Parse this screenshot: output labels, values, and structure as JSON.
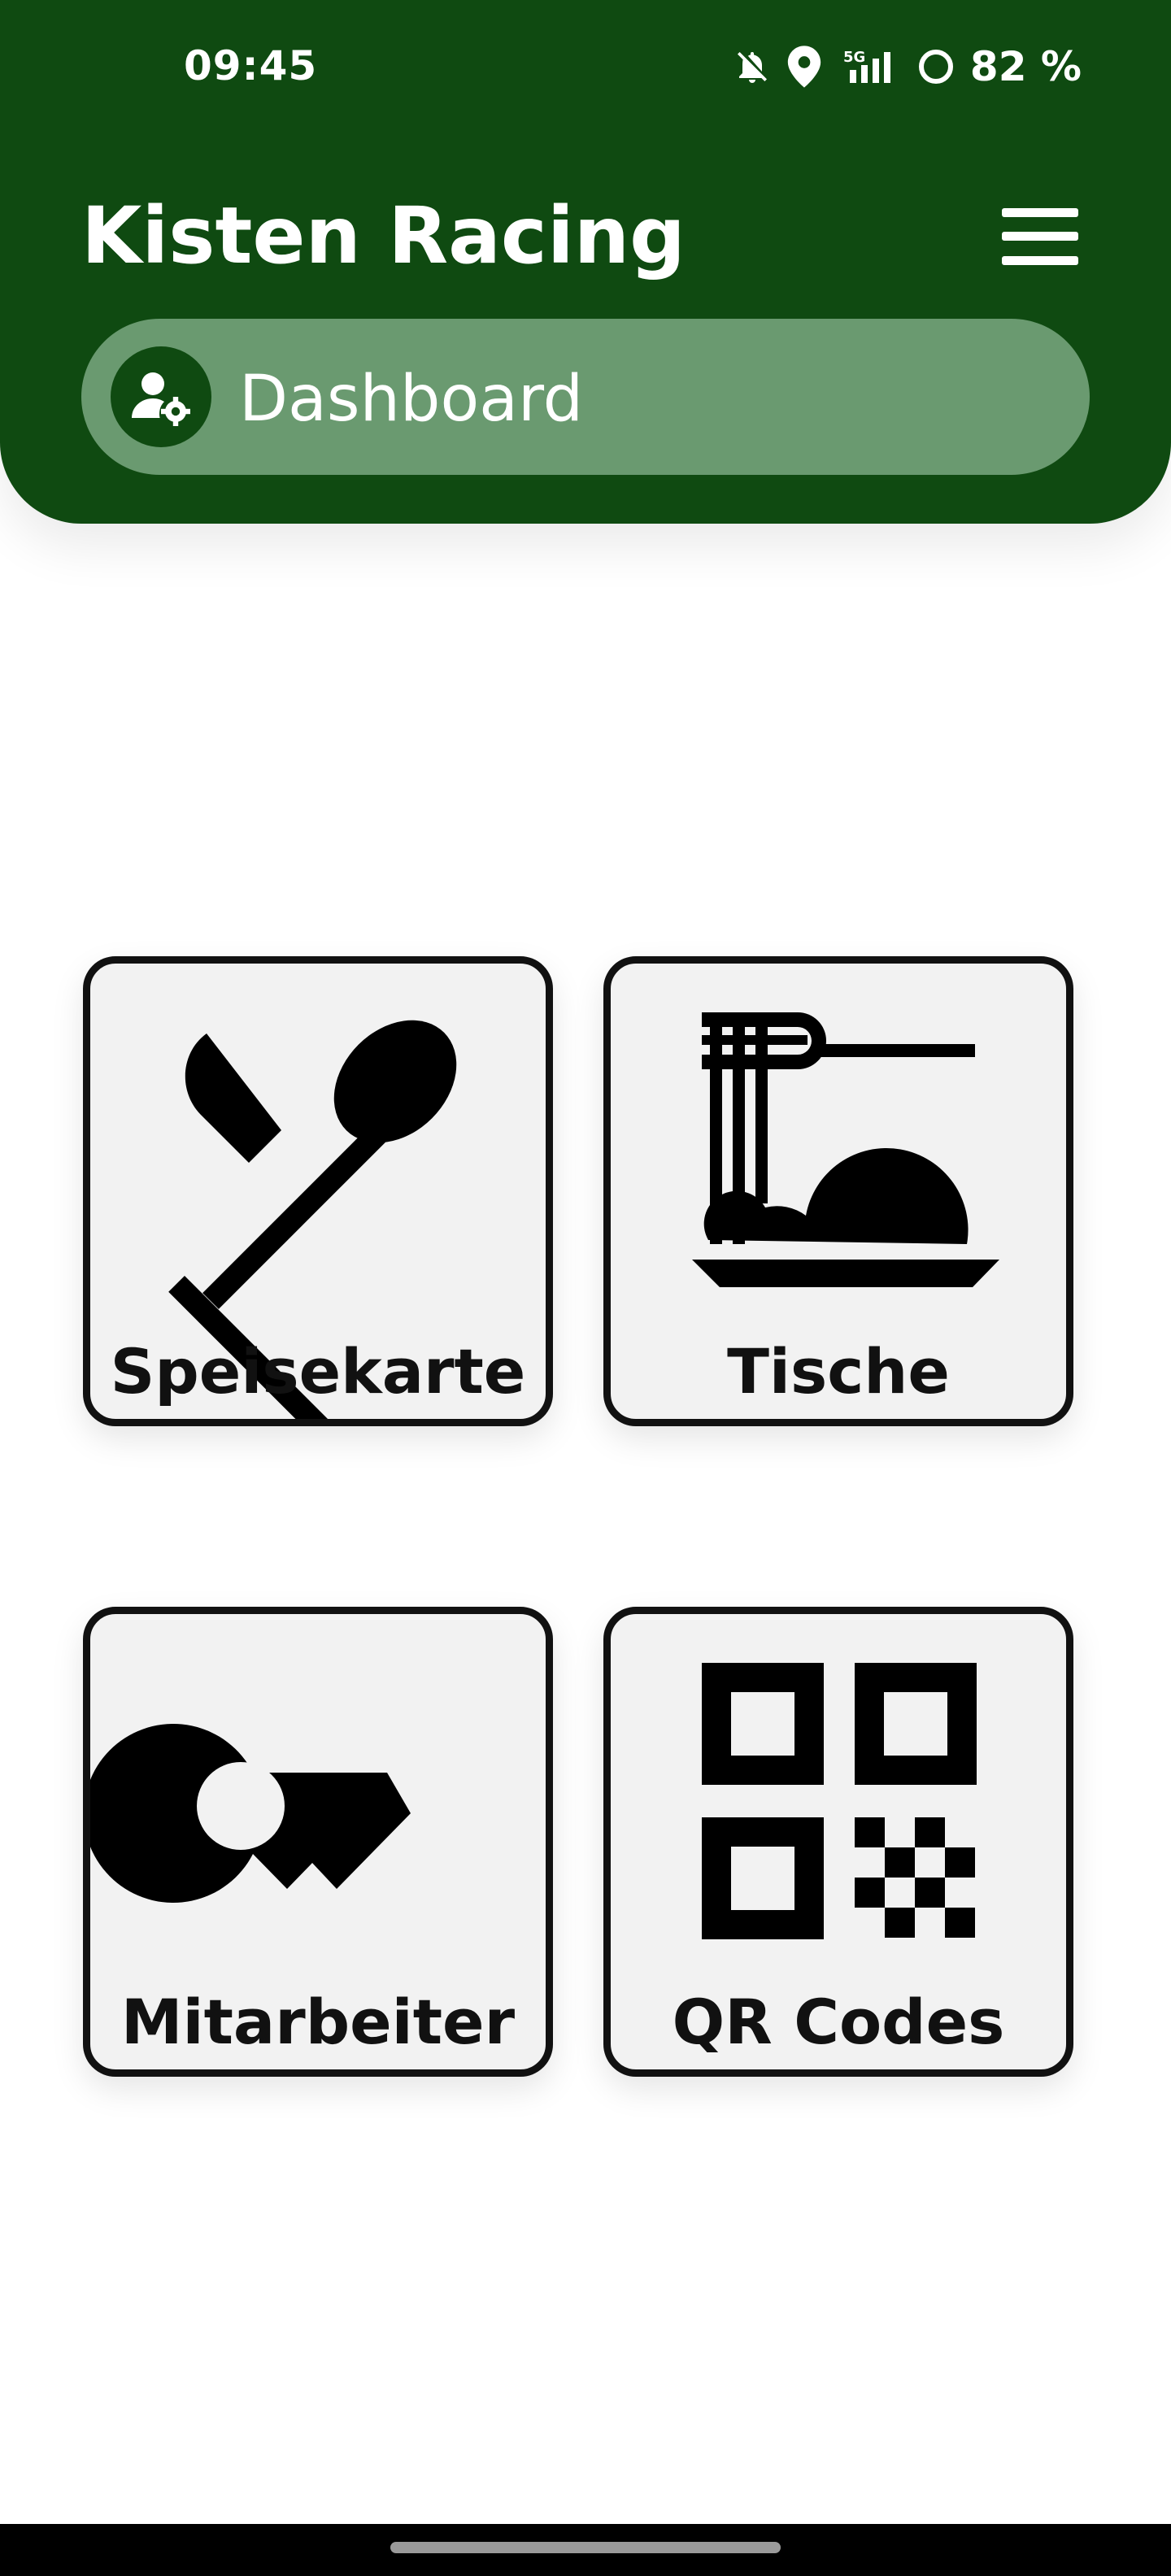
{
  "status_bar": {
    "time": "09:45",
    "network": "5G",
    "battery": "82 %",
    "icons": [
      "bell-off-icon",
      "location-pin-icon",
      "signal-5g-icon",
      "battery-ring-icon"
    ]
  },
  "app": {
    "title": "Kisten Racing",
    "menu_icon": "hamburger-menu-icon"
  },
  "current_page": {
    "label": "Dashboard",
    "icon": "user-settings-icon"
  },
  "tiles": [
    {
      "label": "Speisekarte",
      "icon": "knife-spoon-icon"
    },
    {
      "label": "Tische",
      "icon": "noodle-bowl-icon"
    },
    {
      "label": "Mitarbeiter",
      "icon": "key-icon"
    },
    {
      "label": "QR Codes",
      "icon": "qr-code-icon"
    }
  ],
  "colors": {
    "brand_green": "#0f4a11",
    "pill_green": "#6a9a70",
    "tile_background": "#f2f2f2",
    "tile_border": "#111111"
  }
}
